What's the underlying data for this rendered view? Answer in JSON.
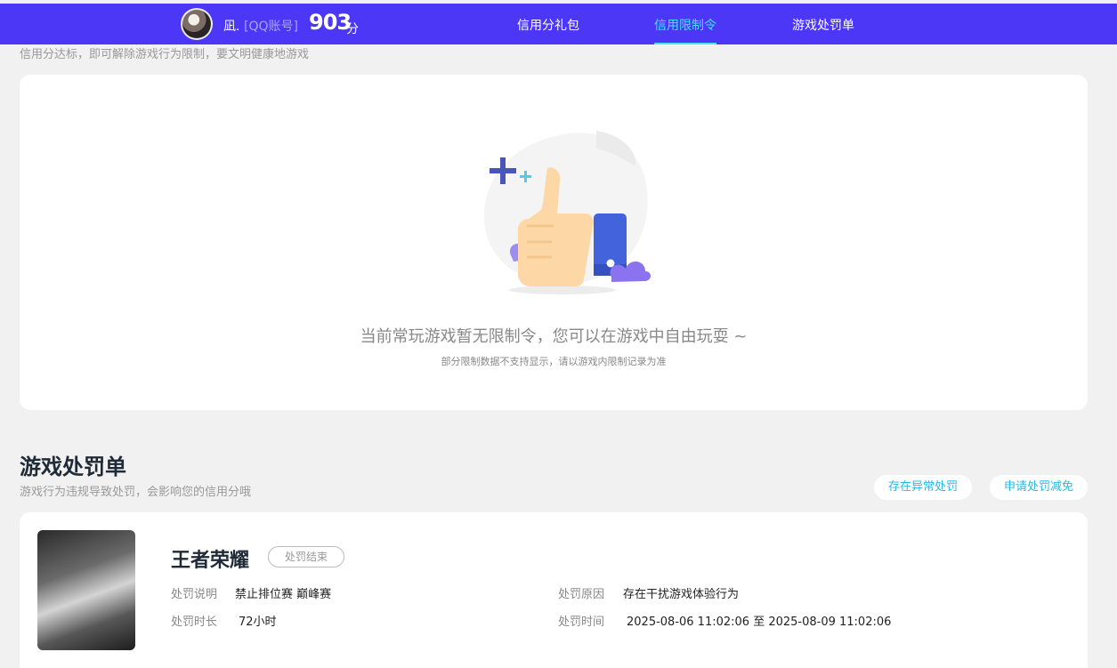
{
  "header": {
    "username": "凪.",
    "account_type": "[QQ账号]",
    "score": "903",
    "score_unit": "分",
    "tabs": [
      {
        "label": "信用分礼包",
        "active": false
      },
      {
        "label": "信用限制令",
        "active": true
      },
      {
        "label": "游戏处罚单",
        "active": false
      }
    ],
    "active_color": "#3fe6ff",
    "bar_color": "#4b37f5"
  },
  "restriction": {
    "note": "信用分达标，即可解除游戏行为限制，要文明健康地游戏",
    "empty_title": "当前常玩游戏暂无限制令，您可以在游戏中自由玩耍 ~",
    "empty_subtitle": "部分限制数据不支持显示，请以游戏内限制记录为准",
    "illustration_icon": "thumbs-up-icon"
  },
  "penalty": {
    "title": "游戏处罚单",
    "subtitle": "游戏行为违规导致处罚，会影响您的信用分哦",
    "buttons": {
      "abnormal": "存在异常处罚",
      "appeal": "申请处罚减免"
    },
    "record": {
      "game": "王者荣耀",
      "status": "处罚结束",
      "desc_label": "处罚说明",
      "desc_value": "禁止排位赛 巅峰赛",
      "duration_label": "处罚时长",
      "duration_value": "72小时",
      "reason_label": "处罚原因",
      "reason_value": "存在干扰游戏体验行为",
      "time_label": "处罚时间",
      "time_value": "2025-08-06 11:02:06 至 2025-08-09 11:02:06"
    }
  }
}
